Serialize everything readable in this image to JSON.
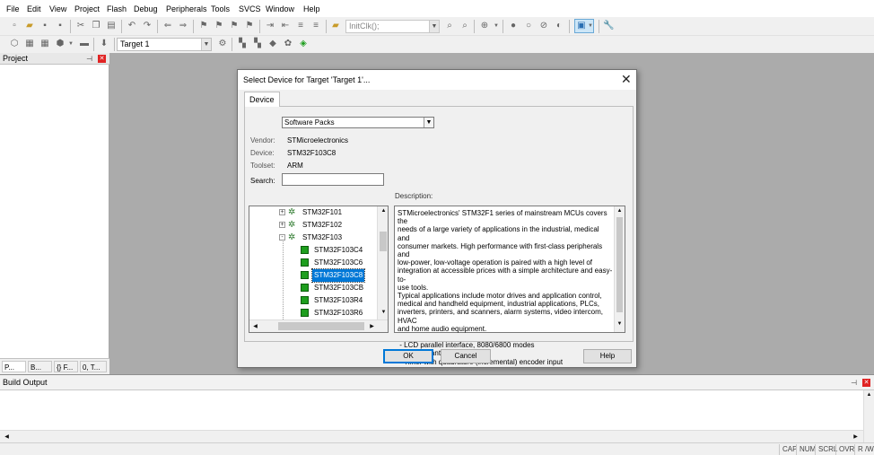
{
  "menubar": {
    "items": [
      "File",
      "Edit",
      "View",
      "Project",
      "Flash",
      "Debug",
      "Peripherals",
      "Tools",
      "SVCS",
      "Window",
      "Help"
    ]
  },
  "toolbar": {
    "find_value": "InitClk();",
    "target_value": "Target 1"
  },
  "project_pane": {
    "title": "Project",
    "tabs": [
      "P...",
      "B...",
      "{} F...",
      "0, T..."
    ]
  },
  "build_output": {
    "title": "Build Output"
  },
  "status_bar": {
    "items": [
      "CAP",
      "NUM",
      "SCRL",
      "OVR",
      "R /W"
    ]
  },
  "dialog": {
    "title": "Select Device for Target 'Target 1'...",
    "tab_label": "Device",
    "pack_select_value": "Software Packs",
    "vendor_label": "Vendor:",
    "vendor_value": "STMicroelectronics",
    "device_label": "Device:",
    "device_value": "STM32F103C8",
    "toolset_label": "Toolset:",
    "toolset_value": "ARM",
    "search_label": "Search:",
    "search_value": "",
    "description_label": "Description:",
    "description_text": "STMicroelectronics' STM32F1 series of mainstream MCUs covers the\nneeds of a large variety of applications in the industrial, medical and\nconsumer markets. High performance with first-class peripherals and\nlow-power, low-voltage operation is paired with a high level of\nintegration at accessible prices with a simple architecture and easy-to-\nuse tools.\nTypical applications include motor drives and application control,\nmedical and handheld equipment, industrial applications, PLCs,\ninverters, printers, and scanners, alarm systems, video intercom, HVAC\nand home audio equipment.\n\n - LCD parallel interface, 8080/6800 modes\n - 5 V-tolerant I/Os\n - Timer with quadrature (incremental) encoder input",
    "tree": {
      "families": [
        {
          "label": "STM32F101",
          "expander": "+"
        },
        {
          "label": "STM32F102",
          "expander": "+"
        },
        {
          "label": "STM32F103",
          "expander": "-"
        }
      ],
      "devices": [
        "STM32F103C4",
        "STM32F103C6",
        "STM32F103C8",
        "STM32F103CB",
        "STM32F103R4",
        "STM32F103R6"
      ],
      "selected": "STM32F103C8"
    },
    "buttons": {
      "ok": "OK",
      "cancel": "Cancel",
      "help": "Help"
    }
  }
}
